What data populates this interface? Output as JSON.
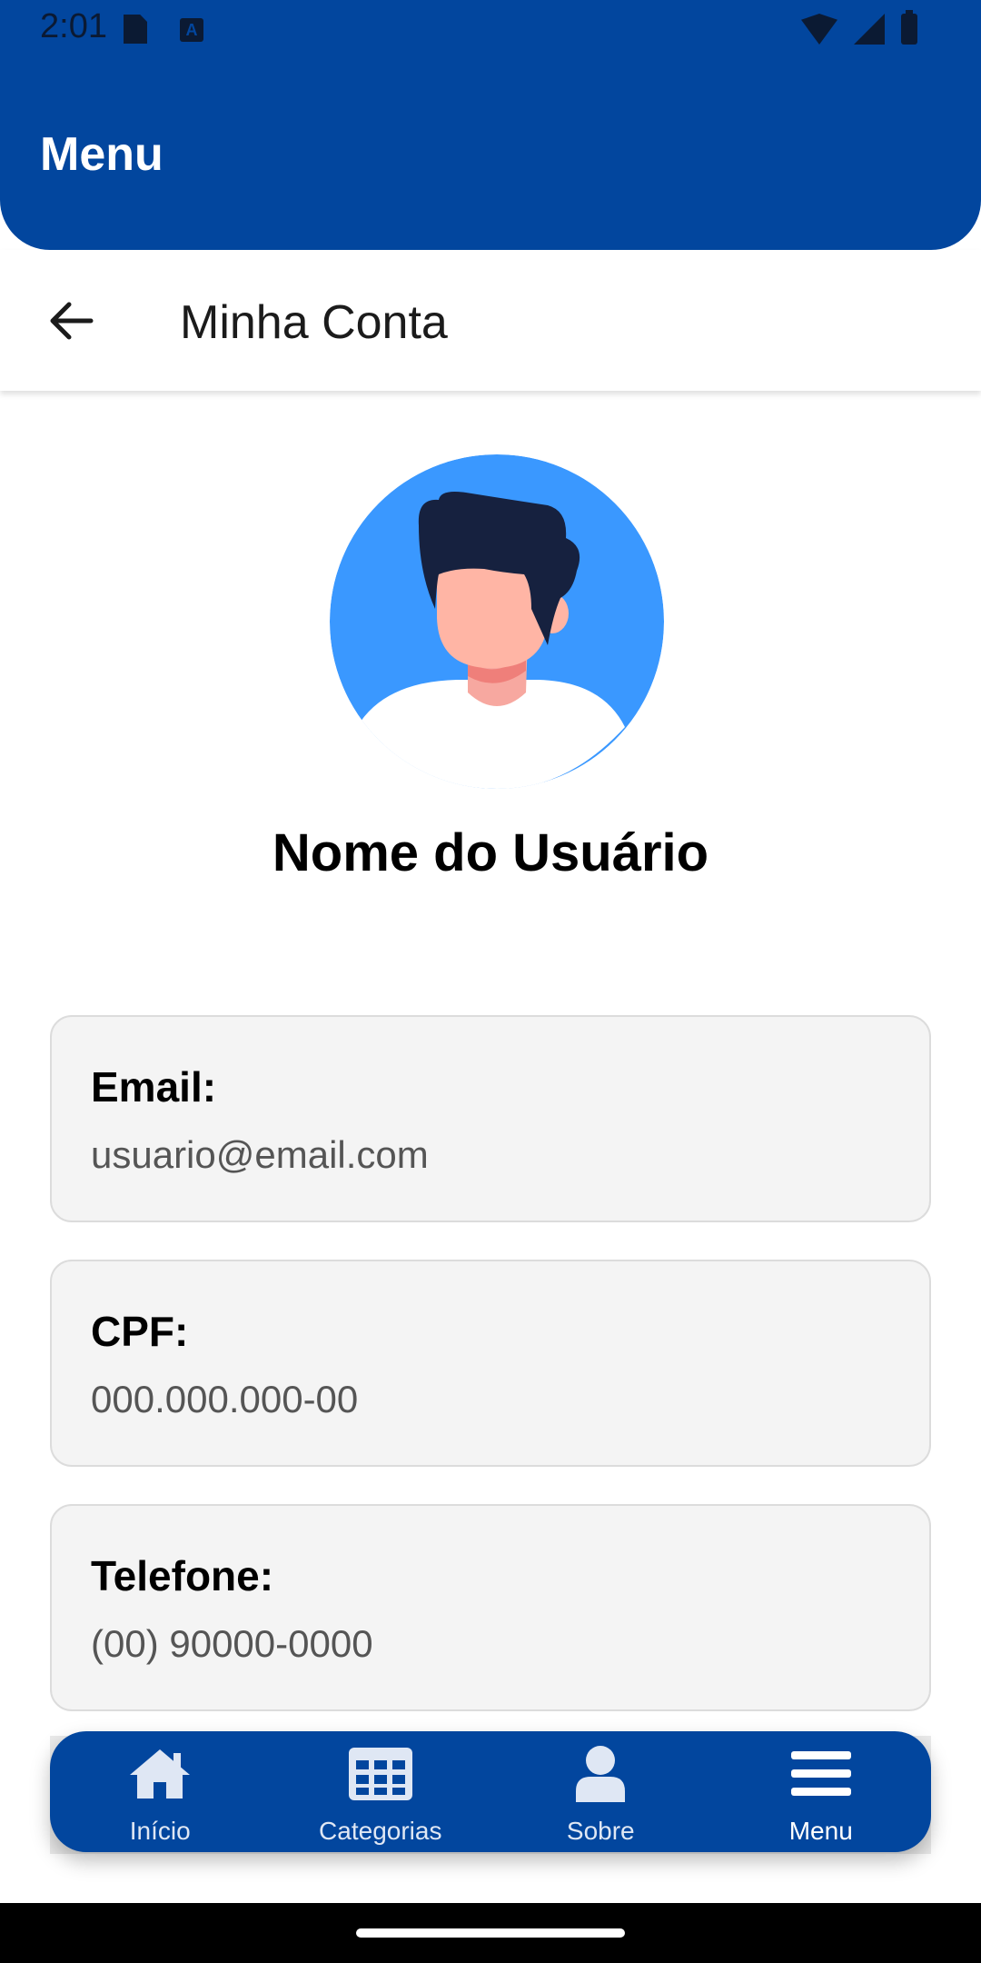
{
  "status_bar": {
    "time": "2:01",
    "keyboard_badge": "A"
  },
  "header": {
    "title": "Menu"
  },
  "toolbar": {
    "title": "Minha Conta"
  },
  "profile": {
    "name": "Nome do Usuário"
  },
  "info_cards": [
    {
      "label": "Email:",
      "value": "usuario@email.com"
    },
    {
      "label": "CPF:",
      "value": "000.000.000-00"
    },
    {
      "label": "Telefone:",
      "value": "(00) 90000-0000"
    }
  ],
  "bottom_nav": {
    "items": [
      {
        "label": "Início",
        "icon": "home-icon"
      },
      {
        "label": "Categorias",
        "icon": "grid-icon"
      },
      {
        "label": "Sobre",
        "icon": "person-icon"
      },
      {
        "label": "Menu",
        "icon": "menu-icon"
      }
    ],
    "active_index": 3
  },
  "colors": {
    "primary": "#02469e",
    "avatar_bg": "#3a98ff",
    "card_bg": "#f4f4f4"
  }
}
